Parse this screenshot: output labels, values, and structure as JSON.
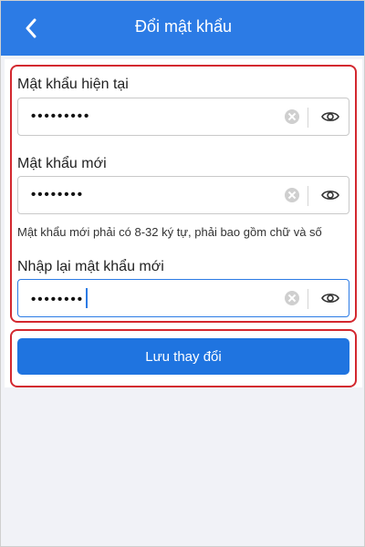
{
  "header": {
    "title": "Đổi mật khẩu",
    "back_icon": "chevron-left-icon"
  },
  "form": {
    "current_password": {
      "label": "Mật khẩu hiện tại",
      "masked_value": "•••••••••"
    },
    "new_password": {
      "label": "Mật khẩu mới",
      "masked_value": "••••••••",
      "hint": "Mật khẩu mới phải có 8-32 ký tự, phải bao gồm chữ và số"
    },
    "confirm_password": {
      "label": "Nhập lại mật khẩu mới",
      "masked_value": "••••••••"
    }
  },
  "actions": {
    "save_label": "Lưu thay đổi"
  },
  "colors": {
    "header": "#2c7be5",
    "button": "#1f74e0",
    "highlight": "#d3282f"
  }
}
